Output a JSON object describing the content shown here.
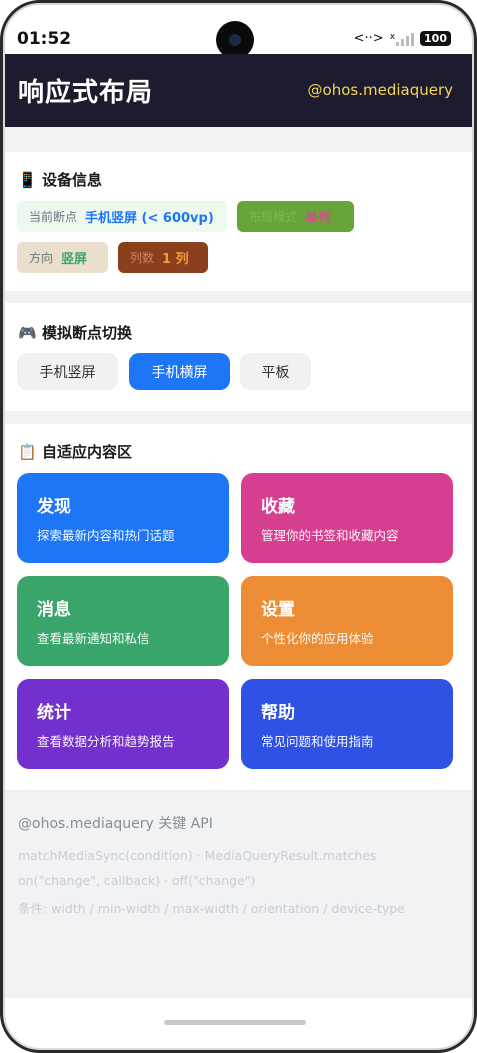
{
  "status_bar": {
    "time": "01:52",
    "network": "<··>",
    "signal_label": "x",
    "battery": "100"
  },
  "header": {
    "title": "响应式布局",
    "subtitle": "@ohos.mediaquery"
  },
  "device_info": {
    "icon": "phone-emoji",
    "title": "设备信息",
    "breakpoint": {
      "label": "当前断点",
      "value": "手机竖屏 (< 600vp)"
    },
    "layout_mode": {
      "label": "布局模式",
      "value": "单列"
    },
    "orientation": {
      "label": "方向",
      "value": "竖屏"
    },
    "columns": {
      "label": "列数",
      "value": "1 列"
    }
  },
  "breakpoint_switch": {
    "icon": "gamepad-emoji",
    "title": "模拟断点切换",
    "buttons": [
      {
        "label": "手机竖屏",
        "active": false
      },
      {
        "label": "手机横屏",
        "active": true
      },
      {
        "label": "平板",
        "active": false
      }
    ]
  },
  "adaptive": {
    "icon": "clipboard-emoji",
    "title": "自适应内容区",
    "tiles": [
      {
        "title": "发现",
        "desc": "探索最新内容和热门话题",
        "color": "#1d76f5"
      },
      {
        "title": "收藏",
        "desc": "管理你的书签和收藏内容",
        "color": "#d63e8f"
      },
      {
        "title": "消息",
        "desc": "查看最新通知和私信",
        "color": "#3aa56b"
      },
      {
        "title": "设置",
        "desc": "个性化你的应用体验",
        "color": "#ec8c35"
      },
      {
        "title": "统计",
        "desc": "查看数据分析和趋势报告",
        "color": "#7430cc"
      },
      {
        "title": "帮助",
        "desc": "常见问题和使用指南",
        "color": "#2f52e4"
      }
    ]
  },
  "api_footer": {
    "title": "@ohos.mediaquery 关键 API",
    "lines": [
      "matchMediaSync(condition) · MediaQueryResult.matches",
      "on(\"change\", callback) · off(\"change\")",
      "条件: width / min-width / max-width / orientation / device-type"
    ]
  },
  "colors": {
    "header_bg": "#1c1c2e",
    "header_accent": "#f2d35b",
    "active_button": "#1d76f5"
  }
}
